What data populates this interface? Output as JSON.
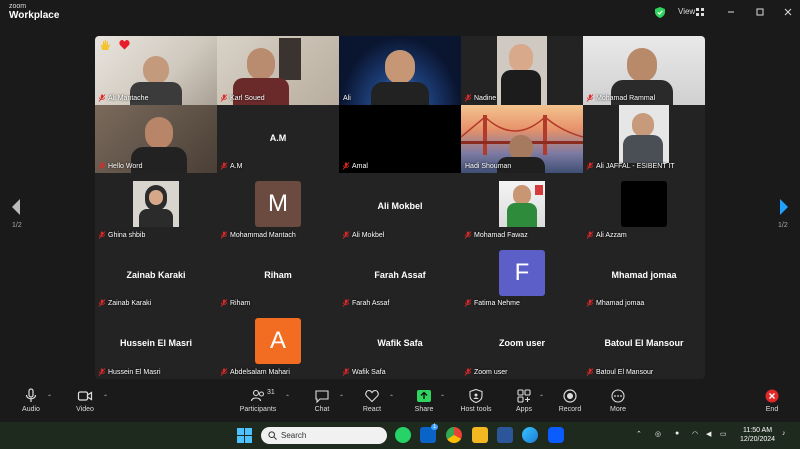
{
  "app": {
    "brand_small": "zoom",
    "brand_big": "Workplace"
  },
  "window": {
    "view_label": "View"
  },
  "pager": {
    "left": "1/2",
    "right": "1/2"
  },
  "participants": [
    {
      "name": "Ali Mantache",
      "type": "video"
    },
    {
      "name": "Karl Soued",
      "type": "video"
    },
    {
      "name": "Ali",
      "type": "video",
      "active": true
    },
    {
      "name": "Nadine",
      "type": "video"
    },
    {
      "name": "Mohamad Rammal",
      "type": "video"
    },
    {
      "name": "Hello Word",
      "type": "video"
    },
    {
      "name": "A.M",
      "type": "text",
      "display": "A.M"
    },
    {
      "name": "Amal",
      "type": "black"
    },
    {
      "name": "Hadi Shouman",
      "type": "video"
    },
    {
      "name": "Ali JAFFAL - ESIBENT IT",
      "type": "video"
    },
    {
      "name": "Ghina shbib",
      "type": "photo"
    },
    {
      "name": "Mohammad Mantach",
      "type": "avatar",
      "letter": "M",
      "color": "#6b4a3f"
    },
    {
      "name": "Ali Mokbel",
      "type": "text",
      "display": "Ali Mokbel"
    },
    {
      "name": "Mohamad Fawaz",
      "type": "photo"
    },
    {
      "name": "Ali Azzam",
      "type": "black-square"
    },
    {
      "name": "Zainab Karaki",
      "type": "text",
      "display": "Zainab Karaki"
    },
    {
      "name": "Riham",
      "type": "text",
      "display": "Riham"
    },
    {
      "name": "Farah Assaf",
      "type": "text",
      "display": "Farah Assaf"
    },
    {
      "name": "Fatima Nehme",
      "type": "avatar",
      "letter": "F",
      "color": "#5b5fc7"
    },
    {
      "name": "Mhamad jomaa",
      "type": "text",
      "display": "Mhamad jomaa"
    },
    {
      "name": "Hussein El Masri",
      "type": "text",
      "display": "Hussein El Masri"
    },
    {
      "name": "Abdelsalam Mahari",
      "type": "avatar",
      "letter": "A",
      "color": "#f26d21"
    },
    {
      "name": "Wafik Safa",
      "type": "text",
      "display": "Wafik Safa"
    },
    {
      "name": "Zoom user",
      "type": "text",
      "display": "Zoom user"
    },
    {
      "name": "Batoul El Mansour",
      "type": "text",
      "display": "Batoul El Mansour"
    }
  ],
  "toolbar": {
    "audio": "Audio",
    "video": "Video",
    "participants": "Participants",
    "participants_count": "31",
    "chat": "Chat",
    "react": "React",
    "share": "Share",
    "host_tools": "Host tools",
    "apps": "Apps",
    "record": "Record",
    "more": "More",
    "end": "End"
  },
  "taskbar": {
    "search_placeholder": "Search",
    "time": "11:50 AM",
    "date": "12/20/2024",
    "outlook_badge": "1"
  },
  "colors": {
    "active_border": "#2fd45e",
    "share_green": "#2fd45e",
    "end_red": "#e02828"
  }
}
